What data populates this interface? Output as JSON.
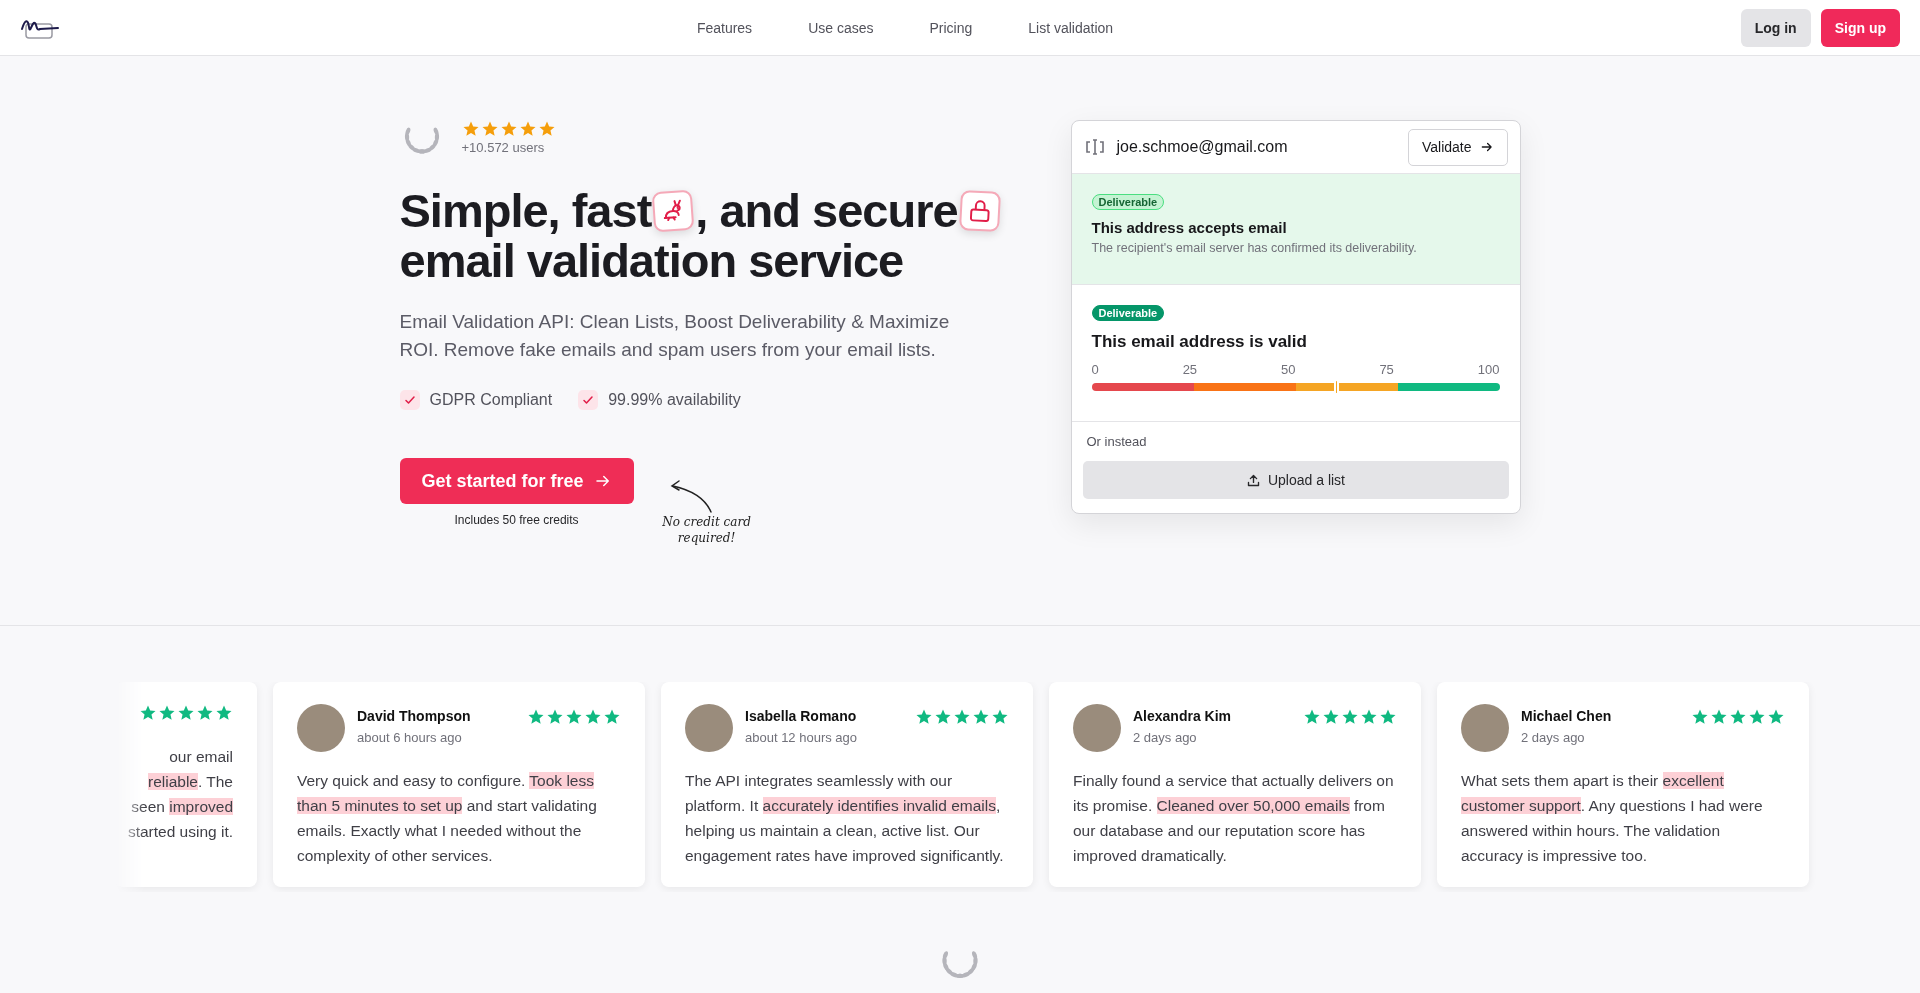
{
  "header": {
    "nav": [
      {
        "label": "Features"
      },
      {
        "label": "Use cases"
      },
      {
        "label": "Pricing"
      },
      {
        "label": "List validation"
      }
    ],
    "login": "Log in",
    "signup": "Sign up"
  },
  "hero": {
    "rating": {
      "stars": 5,
      "users": "+10.572 users"
    },
    "headline": [
      {
        "text": "Simple, fast"
      },
      {
        "text": ", and secure"
      }
    ],
    "headline_line2": "email validation service",
    "subtitle": "Email Validation API: Clean Lists, Boost Deliverability & Maximize ROI. Remove fake emails and spam users from your email lists.",
    "features": [
      {
        "label": "GDPR Compliant",
        "checked": true
      },
      {
        "label": "99.99% availability",
        "checked": true
      }
    ],
    "cta": "Get started for free",
    "cta_note": "Includes 50 free credits",
    "handwritten_note": "No credit card required!"
  },
  "validator": {
    "email": "joe.schmoe@gmail.com",
    "validate": "Validate",
    "results": [
      {
        "kind": "status",
        "badge": "Deliverable",
        "title": "This address accepts email",
        "description": "The recipient's email server has confirmed its deliverability."
      },
      {
        "kind": "score",
        "badge": "Deliverable",
        "title": "This email address is valid",
        "ticks": [
          "0",
          "25",
          "50",
          "75",
          "100"
        ],
        "level": 0.6
      }
    ],
    "alternative": "Or instead",
    "upload": "Upload a list"
  },
  "reviews": [
    {
      "kind": "clipped",
      "stars": 5,
      "lines": [
        [
          {
            "text": "our email",
            "highlight": false
          }
        ],
        [
          {
            "text": "reliable",
            "highlight": true
          },
          {
            "text": ". The",
            "highlight": false
          }
        ],
        [
          {
            "text": "seen ",
            "highlight": false
          },
          {
            "text": "improved",
            "highlight": true
          }
        ],
        [
          {
            "text": "started using it.",
            "highlight": false
          }
        ]
      ]
    },
    {
      "kind": "full",
      "name": "David Thompson",
      "time": "about 6 hours ago",
      "stars": 5,
      "body": [
        {
          "text": "Very quick and easy to configure. ",
          "highlight": false
        },
        {
          "text": "Took less than 5 minutes to set up",
          "highlight": true
        },
        {
          "text": " and start validating emails. Exactly what I needed without the complexity of other services.",
          "highlight": false
        }
      ]
    },
    {
      "kind": "full",
      "name": "Isabella Romano",
      "time": "about 12 hours ago",
      "stars": 5,
      "body": [
        {
          "text": "The API integrates seamlessly with our platform. It ",
          "highlight": false
        },
        {
          "text": "accurately identifies invalid emails",
          "highlight": true
        },
        {
          "text": ", helping us maintain a clean, active list. Our engagement rates have improved significantly.",
          "highlight": false
        }
      ]
    },
    {
      "kind": "full",
      "name": "Alexandra Kim",
      "time": "2 days ago",
      "stars": 5,
      "body": [
        {
          "text": "Finally found a service that actually delivers on its promise. ",
          "highlight": false
        },
        {
          "text": "Cleaned over 50,000 emails",
          "highlight": true
        },
        {
          "text": " from our database and our reputation score has improved dramatically.",
          "highlight": false
        }
      ]
    },
    {
      "kind": "full",
      "name": "Michael Chen",
      "time": "2 days ago",
      "stars": 5,
      "body": [
        {
          "text": "What sets them apart is their ",
          "highlight": false
        },
        {
          "text": "excellent customer support",
          "highlight": true
        },
        {
          "text": ". Any questions I had were answered within hours. The validation accuracy is impressive too.",
          "highlight": false
        }
      ]
    }
  ]
}
